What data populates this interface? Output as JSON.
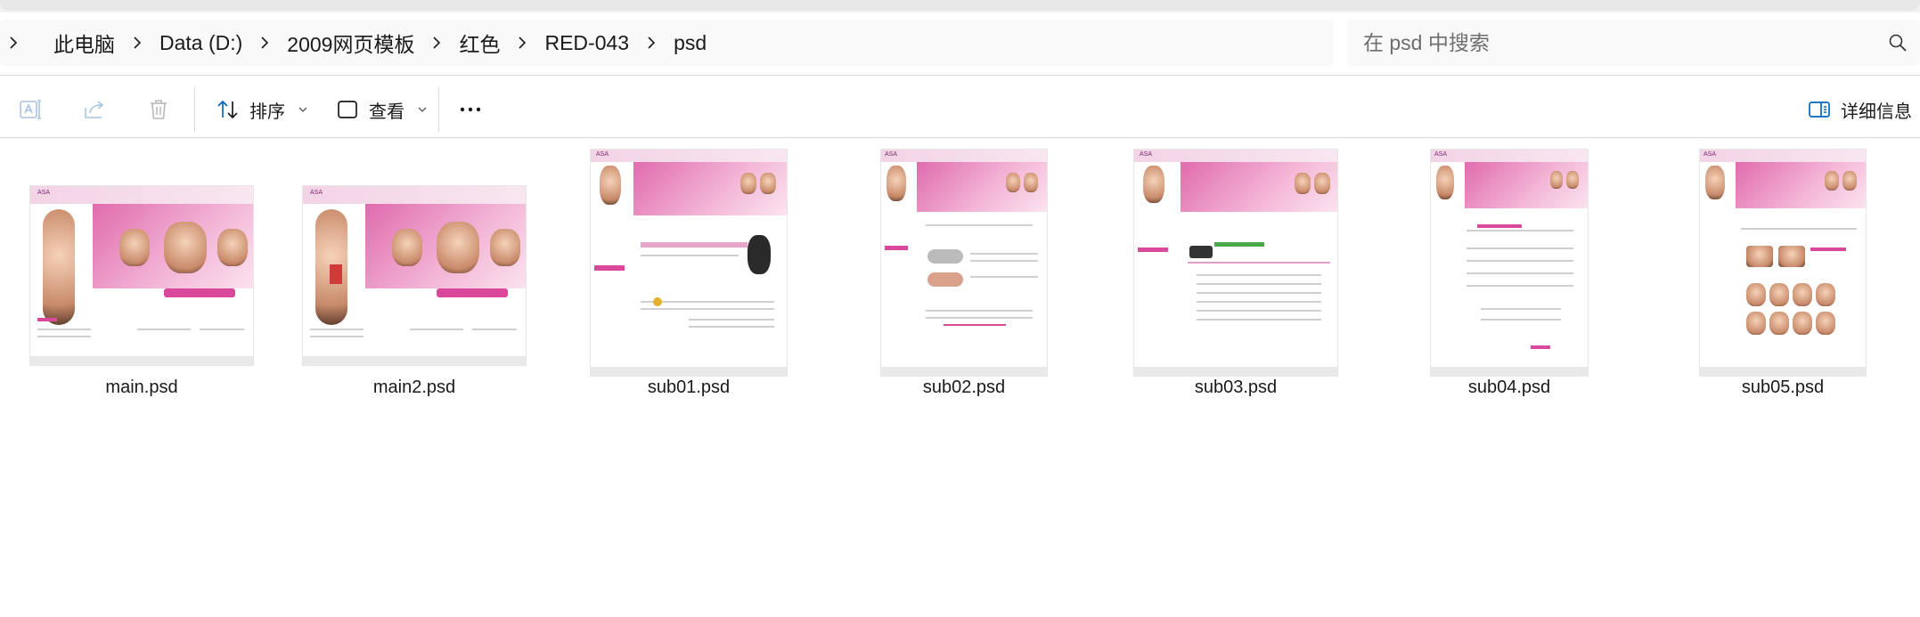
{
  "breadcrumb": {
    "items": [
      "此电脑",
      "Data (D:)",
      "2009网页模板",
      "红色",
      "RED-043",
      "psd"
    ]
  },
  "search": {
    "placeholder": "在 psd 中搜索"
  },
  "toolbar": {
    "sort_label": "排序",
    "view_label": "查看",
    "details_label": "详细信息"
  },
  "files": [
    {
      "name": "main.psd"
    },
    {
      "name": "main2.psd"
    },
    {
      "name": "sub01.psd"
    },
    {
      "name": "sub02.psd"
    },
    {
      "name": "sub03.psd"
    },
    {
      "name": "sub04.psd"
    },
    {
      "name": "sub05.psd"
    }
  ],
  "icons": {
    "rename": "rename-icon",
    "share": "share-icon",
    "delete": "delete-icon",
    "sort": "sort-icon",
    "view": "view-icon",
    "more": "more-icon",
    "details": "details-pane-icon",
    "search": "search-icon",
    "chevron": "chevron-right-icon"
  },
  "colors": {
    "accent": "#0067c0",
    "thumb_pink": "#d9489a"
  }
}
